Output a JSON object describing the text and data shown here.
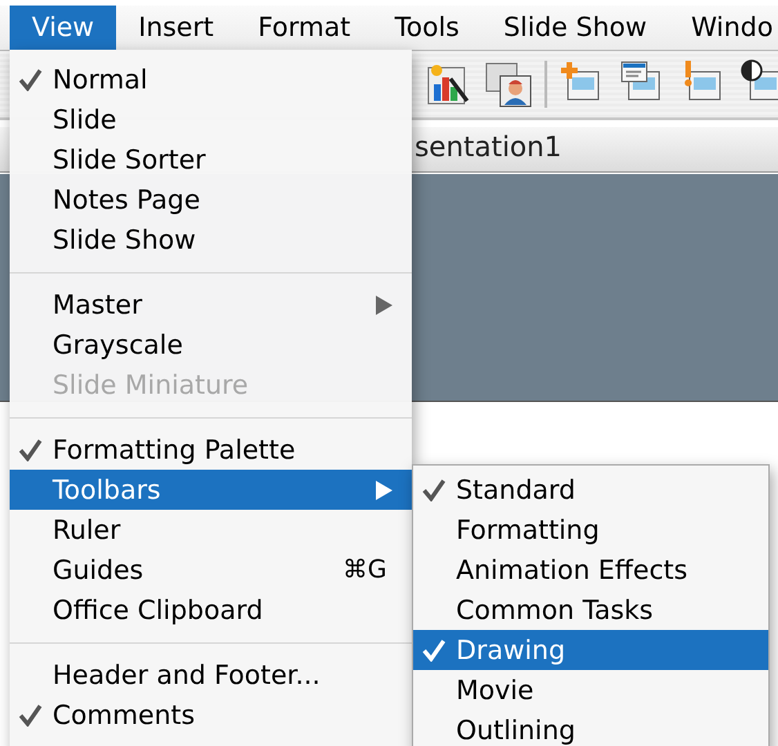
{
  "menubar": [
    {
      "label": "View",
      "selected": true
    },
    {
      "label": "Insert",
      "selected": false
    },
    {
      "label": "Format",
      "selected": false
    },
    {
      "label": "Tools",
      "selected": false
    },
    {
      "label": "Slide Show",
      "selected": false
    },
    {
      "label": "Windo",
      "selected": false
    }
  ],
  "document": {
    "title": "sentation1"
  },
  "view_menu": {
    "items": [
      {
        "kind": "item",
        "label": "Normal",
        "checked": true,
        "disabled": false,
        "selected": false,
        "submenu": false
      },
      {
        "kind": "item",
        "label": "Slide",
        "checked": false,
        "disabled": false,
        "selected": false,
        "submenu": false
      },
      {
        "kind": "item",
        "label": "Slide Sorter",
        "checked": false,
        "disabled": false,
        "selected": false,
        "submenu": false
      },
      {
        "kind": "item",
        "label": "Notes Page",
        "checked": false,
        "disabled": false,
        "selected": false,
        "submenu": false
      },
      {
        "kind": "item",
        "label": "Slide Show",
        "checked": false,
        "disabled": false,
        "selected": false,
        "submenu": false
      },
      {
        "kind": "separator"
      },
      {
        "kind": "item",
        "label": "Master",
        "checked": false,
        "disabled": false,
        "selected": false,
        "submenu": true
      },
      {
        "kind": "item",
        "label": "Grayscale",
        "checked": false,
        "disabled": false,
        "selected": false,
        "submenu": false
      },
      {
        "kind": "item",
        "label": "Slide Miniature",
        "checked": false,
        "disabled": true,
        "selected": false,
        "submenu": false
      },
      {
        "kind": "separator"
      },
      {
        "kind": "item",
        "label": "Formatting Palette",
        "checked": true,
        "disabled": false,
        "selected": false,
        "submenu": false
      },
      {
        "kind": "item",
        "label": "Toolbars",
        "checked": false,
        "disabled": false,
        "selected": true,
        "submenu": true
      },
      {
        "kind": "item",
        "label": "Ruler",
        "checked": false,
        "disabled": false,
        "selected": false,
        "submenu": false
      },
      {
        "kind": "item",
        "label": "Guides",
        "checked": false,
        "disabled": false,
        "selected": false,
        "submenu": false,
        "shortcut": "⌘G"
      },
      {
        "kind": "item",
        "label": "Office Clipboard",
        "checked": false,
        "disabled": false,
        "selected": false,
        "submenu": false
      },
      {
        "kind": "separator"
      },
      {
        "kind": "item",
        "label": "Header and Footer...",
        "checked": false,
        "disabled": false,
        "selected": false,
        "submenu": false
      },
      {
        "kind": "item",
        "label": "Comments",
        "checked": true,
        "disabled": false,
        "selected": false,
        "submenu": false
      }
    ]
  },
  "toolbars_submenu": {
    "items": [
      {
        "label": "Standard",
        "checked": true,
        "selected": false
      },
      {
        "label": "Formatting",
        "checked": false,
        "selected": false
      },
      {
        "label": "Animation Effects",
        "checked": false,
        "selected": false
      },
      {
        "label": "Common Tasks",
        "checked": false,
        "selected": false
      },
      {
        "label": "Drawing",
        "checked": true,
        "selected": true
      },
      {
        "label": "Movie",
        "checked": false,
        "selected": false
      },
      {
        "label": "Outlining",
        "checked": false,
        "selected": false
      }
    ]
  }
}
